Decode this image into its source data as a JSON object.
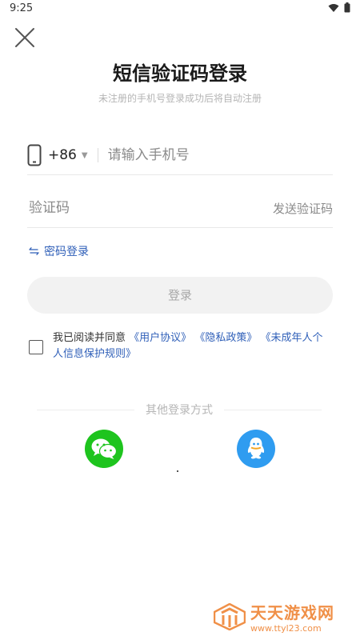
{
  "status": {
    "time": "9:25"
  },
  "header": {
    "title": "短信验证码登录",
    "subtitle": "未注册的手机号登录成功后将自动注册"
  },
  "phone": {
    "country_code": "+86",
    "placeholder": "请输入手机号"
  },
  "code": {
    "placeholder": "验证码",
    "send_label": "发送验证码"
  },
  "password_login": {
    "icon": "swap-icon",
    "label": "密码登录"
  },
  "login_button": "登录",
  "agreement": {
    "prefix": "我已阅读并同意",
    "user_agreement": "《用户协议》",
    "privacy_policy": "《隐私政策》",
    "minor_rules": "《未成年人个人信息保护规则》"
  },
  "other_login": {
    "title": "其他登录方式",
    "providers": [
      "wechat-icon",
      "qq-icon"
    ]
  },
  "watermark": {
    "title": "天天游戏网",
    "url": "www.ttyl23.com"
  },
  "colors": {
    "link": "#2f5fb8",
    "wechat": "#1ec41e",
    "qq": "#2f9cf0",
    "watermark": "#f09048"
  }
}
